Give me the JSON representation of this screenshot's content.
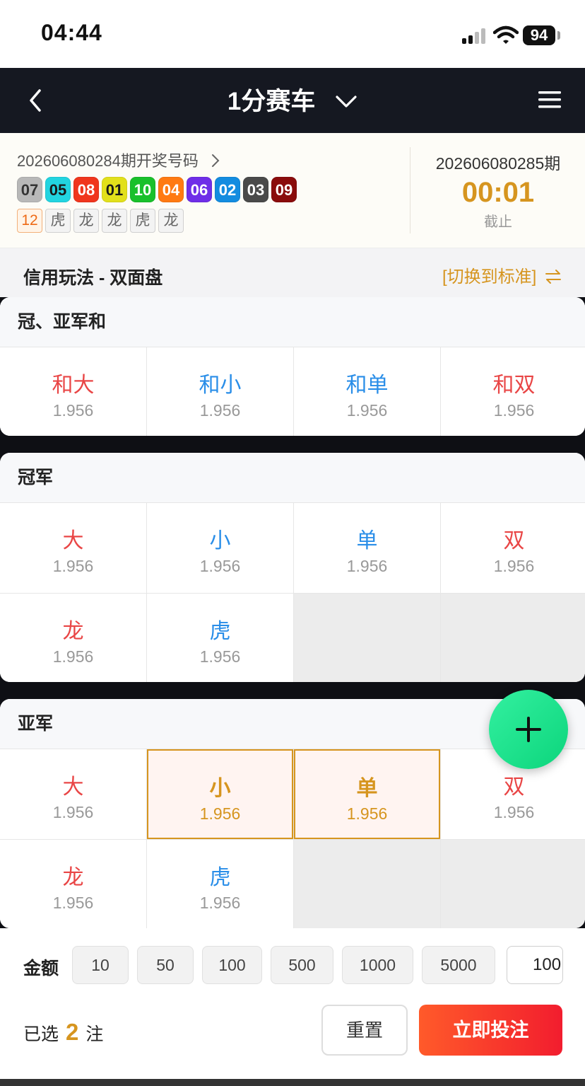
{
  "status_bar": {
    "time": "04:44",
    "battery": "94"
  },
  "nav": {
    "title": "1分赛车"
  },
  "draw": {
    "prev_title": "202606080284期开奖号码",
    "balls": [
      {
        "num": "07",
        "color": "#b8b8b8",
        "text_color": "#333333"
      },
      {
        "num": "05",
        "color": "#22d4e0",
        "text_color": "#1a1a1a"
      },
      {
        "num": "08",
        "color": "#f0361d",
        "text_color": "#ffffff"
      },
      {
        "num": "01",
        "color": "#e2e01b",
        "text_color": "#1a1a1a"
      },
      {
        "num": "10",
        "color": "#19c02b",
        "text_color": "#ffffff"
      },
      {
        "num": "04",
        "color": "#ff7a12",
        "text_color": "#ffffff"
      },
      {
        "num": "06",
        "color": "#6f2ee8",
        "text_color": "#ffffff"
      },
      {
        "num": "02",
        "color": "#138ce0",
        "text_color": "#ffffff"
      },
      {
        "num": "03",
        "color": "#4a4a4a",
        "text_color": "#ffffff"
      },
      {
        "num": "09",
        "color": "#8a0c0c",
        "text_color": "#ffffff"
      }
    ],
    "tags": [
      "12",
      "虎",
      "龙",
      "龙",
      "虎",
      "龙"
    ],
    "next_period": "202606080285期",
    "countdown": "00:01",
    "countdown_label": "截止"
  },
  "play": {
    "title": "信用玩法 - 双面盘",
    "switch_label": "[切换到标准]"
  },
  "sections": [
    {
      "title": "冠、亚军和",
      "cells": [
        {
          "label": "和大",
          "odds": "1.956",
          "color": "red"
        },
        {
          "label": "和小",
          "odds": "1.956",
          "color": "blue"
        },
        {
          "label": "和单",
          "odds": "1.956",
          "color": "blue"
        },
        {
          "label": "和双",
          "odds": "1.956",
          "color": "red"
        }
      ]
    },
    {
      "title": "冠军",
      "cells": [
        {
          "label": "大",
          "odds": "1.956",
          "color": "red"
        },
        {
          "label": "小",
          "odds": "1.956",
          "color": "blue"
        },
        {
          "label": "单",
          "odds": "1.956",
          "color": "blue"
        },
        {
          "label": "双",
          "odds": "1.956",
          "color": "red"
        },
        {
          "label": "龙",
          "odds": "1.956",
          "color": "red"
        },
        {
          "label": "虎",
          "odds": "1.956",
          "color": "blue"
        }
      ]
    },
    {
      "title": "亚军",
      "cells": [
        {
          "label": "大",
          "odds": "1.956",
          "color": "red"
        },
        {
          "label": "小",
          "odds": "1.956",
          "color": "blue",
          "selected": true
        },
        {
          "label": "单",
          "odds": "1.956",
          "color": "blue",
          "selected": true
        },
        {
          "label": "双",
          "odds": "1.956",
          "color": "red"
        },
        {
          "label": "龙",
          "odds": "1.956",
          "color": "red"
        },
        {
          "label": "虎",
          "odds": "1.956",
          "color": "blue"
        }
      ]
    }
  ],
  "bet": {
    "amount_label": "金额",
    "chips": [
      "10",
      "50",
      "100",
      "500",
      "1000",
      "5000"
    ],
    "amount_value": "100",
    "selected_prefix": "已选",
    "selected_count": "2",
    "selected_suffix": "注",
    "reset_label": "重置",
    "submit_label": "立即投注"
  },
  "colors": {
    "accent": "#d6951f",
    "red": "#e94646",
    "blue": "#2a8ee8"
  }
}
